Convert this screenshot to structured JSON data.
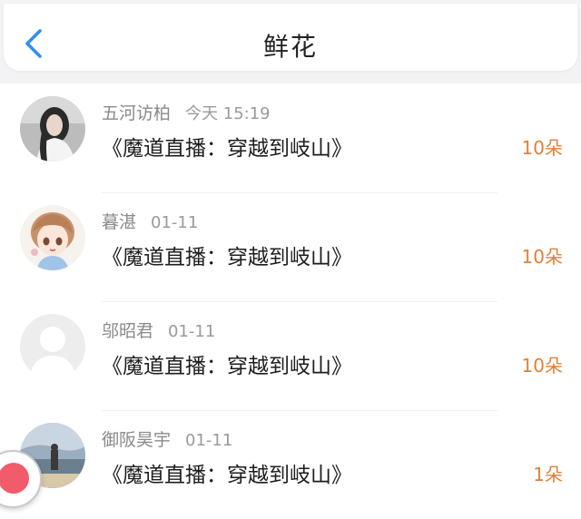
{
  "header": {
    "title": "鲜花",
    "back_icon": "chevron-left-icon",
    "accent_color": "#2f8ff0"
  },
  "items": [
    {
      "name": "五河访柏",
      "time": "今天 15:19",
      "book": "《魔道直播：穿越到岐山》",
      "quantity": "10朵",
      "avatar": "avatar-girl-photo"
    },
    {
      "name": "暮湛",
      "time": "01-11",
      "book": "《魔道直播：穿越到岐山》",
      "quantity": "10朵",
      "avatar": "avatar-anime-girl"
    },
    {
      "name": "邬昭君",
      "time": "01-11",
      "book": "《魔道直播：穿越到岐山》",
      "quantity": "10朵",
      "avatar": "avatar-default"
    },
    {
      "name": "御阪昊宇",
      "time": "01-11",
      "book": "《魔道直播：穿越到岐山》",
      "quantity": "1朵",
      "avatar": "avatar-landscape-photo"
    }
  ],
  "colors": {
    "quantity": "#e0803a",
    "meta_text": "#8a8a8a",
    "title_text": "#1d1d1d"
  }
}
